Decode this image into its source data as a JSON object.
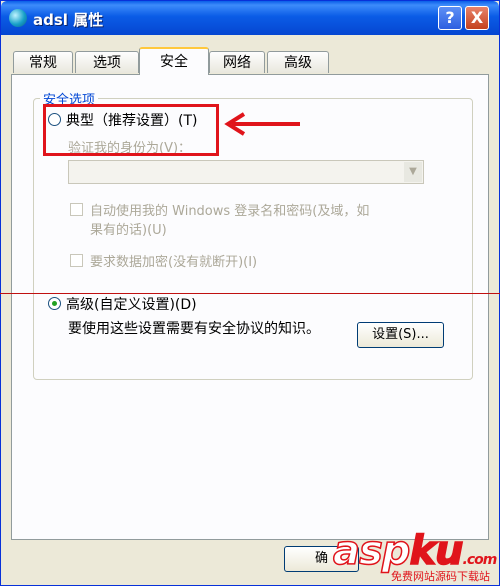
{
  "window": {
    "title": "adsl 属性",
    "help_label": "?",
    "close_label": "X"
  },
  "tabs": [
    {
      "label": "常规"
    },
    {
      "label": "选项"
    },
    {
      "label": "安全",
      "active": true
    },
    {
      "label": "网络"
    },
    {
      "label": "高级"
    }
  ],
  "security": {
    "group_label": "安全选项",
    "typical_label": "典型（推荐设置）(T)",
    "verify_label": "验证我的身份为(V)：",
    "verify_value": "",
    "auto_login_line1": "自动使用我的 Windows 登录名和密码(及域，如",
    "auto_login_line2": "果有的话)(U)",
    "require_encryption": "要求数据加密(没有就断开)(I)",
    "advanced_label": "高级(自定义设置)(D)",
    "advanced_desc": "要使用这些设置需要有安全协议的知识。",
    "settings_button": "设置(S)..."
  },
  "footer": {
    "ok_label": "确"
  },
  "watermark": {
    "brand_main": "asp",
    "brand_accent": "ku",
    "brand_suffix": ".com",
    "subtext": "免费网站源码下载站"
  },
  "colors": {
    "titlebar": "#0b5ce6",
    "dialog_bg": "#ece9d8",
    "accent_red": "#e0141b",
    "legend_blue": "#0046d5"
  }
}
